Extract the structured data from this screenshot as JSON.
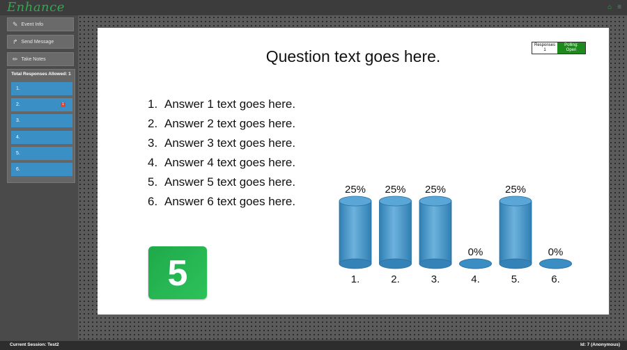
{
  "app": {
    "logo_text": "Enhance"
  },
  "top_icons": [
    "home-icon",
    "menu-icon"
  ],
  "sidebar": {
    "buttons": [
      {
        "label": "Event Info",
        "icon": "edit-icon"
      },
      {
        "label": "Send Message",
        "icon": "share-arrow-icon"
      },
      {
        "label": "Take Notes",
        "icon": "pencil-icon"
      }
    ],
    "responses_title": "Total Responses Allowed: 1",
    "response_items": [
      {
        "label": "1.",
        "badge": ""
      },
      {
        "label": "2.",
        "badge": "1"
      },
      {
        "label": "3.",
        "badge": ""
      },
      {
        "label": "4.",
        "badge": ""
      },
      {
        "label": "5.",
        "badge": ""
      },
      {
        "label": "6.",
        "badge": ""
      }
    ]
  },
  "slide": {
    "question": "Question text goes here.",
    "responses_label": "Responses",
    "responses_count": "1",
    "polling_label": "Polling:",
    "polling_status": "Open",
    "answers": [
      {
        "num": "1.",
        "text": "Answer 1 text goes here."
      },
      {
        "num": "2.",
        "text": "Answer 2 text goes here."
      },
      {
        "num": "3.",
        "text": "Answer 3 text goes here."
      },
      {
        "num": "4.",
        "text": "Answer 4 text goes here."
      },
      {
        "num": "5.",
        "text": "Answer 5 text goes here."
      },
      {
        "num": "6.",
        "text": "Answer 6 text goes here."
      }
    ],
    "countdown": "5"
  },
  "chart_data": {
    "type": "bar",
    "categories": [
      "1.",
      "2.",
      "3.",
      "4.",
      "5.",
      "6."
    ],
    "values": [
      25,
      25,
      25,
      0,
      25,
      0
    ],
    "value_labels": [
      "25%",
      "25%",
      "25%",
      "0%",
      "25%",
      "0%"
    ],
    "ylim": [
      0,
      25
    ],
    "bar_style": "cylinder",
    "bar_color": "#3a8ec4"
  },
  "footer": {
    "session": "Current Session: Test2",
    "id": "Id: 7 (Anonymous)"
  }
}
